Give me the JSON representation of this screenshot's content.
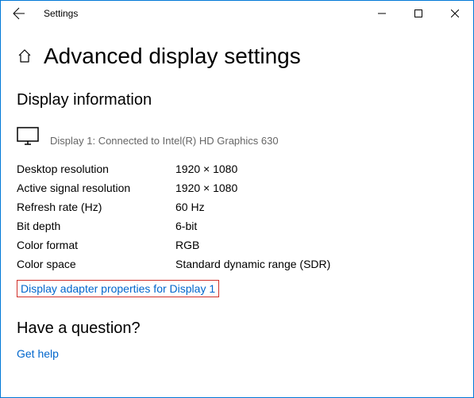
{
  "window": {
    "app_title": "Settings"
  },
  "page": {
    "title": "Advanced display settings",
    "section_title": "Display information",
    "monitor_label": "Display 1: Connected to Intel(R) HD Graphics 630",
    "props": [
      {
        "label": "Desktop resolution",
        "value": "1920 × 1080"
      },
      {
        "label": "Active signal resolution",
        "value": "1920 × 1080"
      },
      {
        "label": "Refresh rate (Hz)",
        "value": "60 Hz"
      },
      {
        "label": "Bit depth",
        "value": "6-bit"
      },
      {
        "label": "Color format",
        "value": "RGB"
      },
      {
        "label": "Color space",
        "value": "Standard dynamic range (SDR)"
      }
    ],
    "adapter_link": "Display adapter properties for Display 1",
    "question_title": "Have a question?",
    "help_link": "Get help"
  }
}
